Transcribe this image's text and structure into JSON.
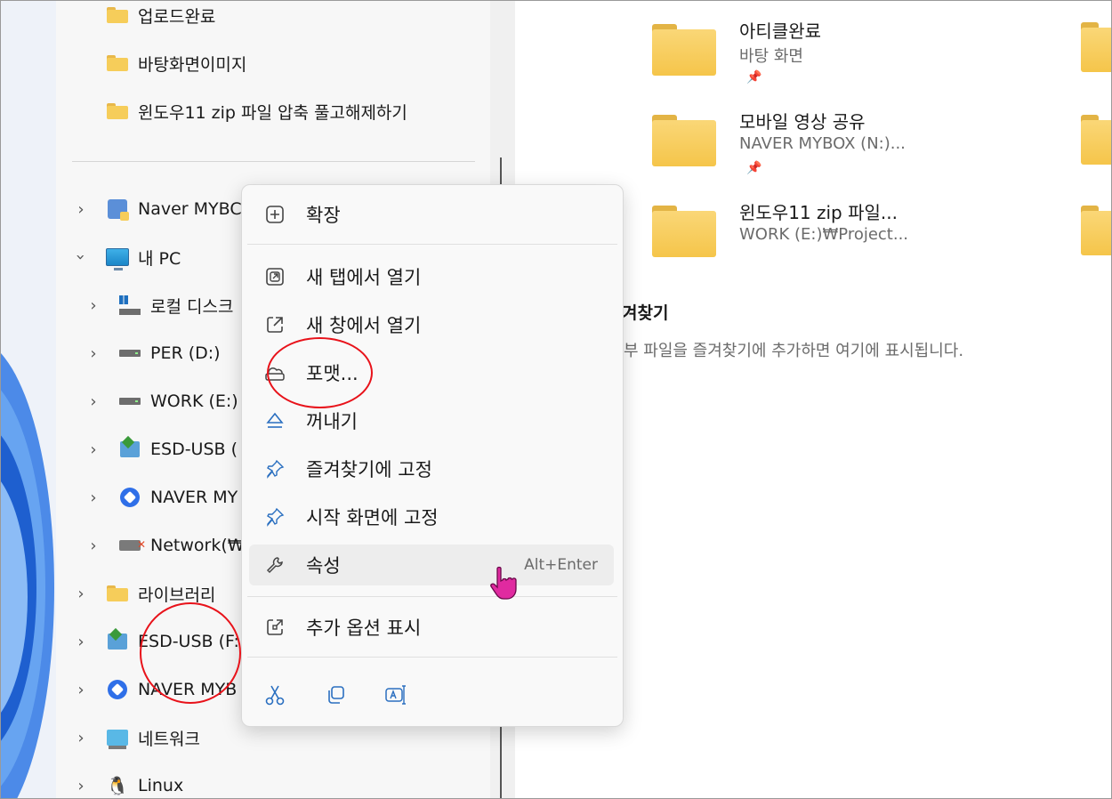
{
  "nav": {
    "quick_folders": [
      {
        "label": "업로드완료"
      },
      {
        "label": "바탕화면이미지"
      },
      {
        "label": "윈도우11 zip 파일 압축 풀고해제하기"
      }
    ],
    "items": [
      {
        "label": "Naver MYBC",
        "icon": "mybox-icon"
      },
      {
        "label": "내 PC",
        "icon": "computer-icon"
      },
      {
        "label": "로컬 디스크",
        "icon": "local-disk-icon"
      },
      {
        "label": "PER (D:)",
        "icon": "drive-icon"
      },
      {
        "label": "WORK (E:)",
        "icon": "drive-icon"
      },
      {
        "label": "ESD-USB (",
        "icon": "usb-drive-icon"
      },
      {
        "label": "NAVER MY",
        "icon": "naver-icon"
      },
      {
        "label": "Network(₩",
        "icon": "network-drive-icon"
      },
      {
        "label": "라이브러리",
        "icon": "folder-icon"
      },
      {
        "label": "ESD-USB (F:",
        "icon": "usb-drive-icon"
      },
      {
        "label": "NAVER MYB",
        "icon": "naver-icon"
      },
      {
        "label": "네트워크",
        "icon": "network-icon"
      },
      {
        "label": "Linux",
        "icon": "linux-icon"
      }
    ]
  },
  "quick_access": [
    {
      "name": "아티클완료",
      "location": "바탕 화면"
    },
    {
      "name": "모바일 영상 공유",
      "location": "NAVER MYBOX (N:)..."
    },
    {
      "name": "윈도우11 zip 파일...",
      "location": "WORK (E:)₩Project..."
    }
  ],
  "favorites": {
    "heading": "겨찾기",
    "empty_text": "부 파일을 즐겨찾기에 추가하면 여기에 표시됩니다."
  },
  "context_menu": {
    "items": [
      {
        "label": "확장",
        "icon": "expand-icon"
      },
      {
        "label": "새 탭에서 열기",
        "icon": "open-new-tab-icon"
      },
      {
        "label": "새 창에서 열기",
        "icon": "open-new-window-icon"
      },
      {
        "label": "포맷...",
        "icon": "format-icon"
      },
      {
        "label": "꺼내기",
        "icon": "eject-icon"
      },
      {
        "label": "즐겨찾기에 고정",
        "icon": "pin-icon"
      },
      {
        "label": "시작 화면에 고정",
        "icon": "pin-icon"
      },
      {
        "label": "속성",
        "icon": "wrench-icon",
        "shortcut": "Alt+Enter"
      },
      {
        "label": "추가 옵션 표시",
        "icon": "more-options-icon"
      }
    ],
    "bottom_buttons": [
      "cut-icon",
      "copy-icon",
      "rename-icon"
    ]
  },
  "colors": {
    "annotation": "#e8121a",
    "folder": "#f6cd5a",
    "accent": "#2a6fc0",
    "cursor": "#e02aa0"
  }
}
